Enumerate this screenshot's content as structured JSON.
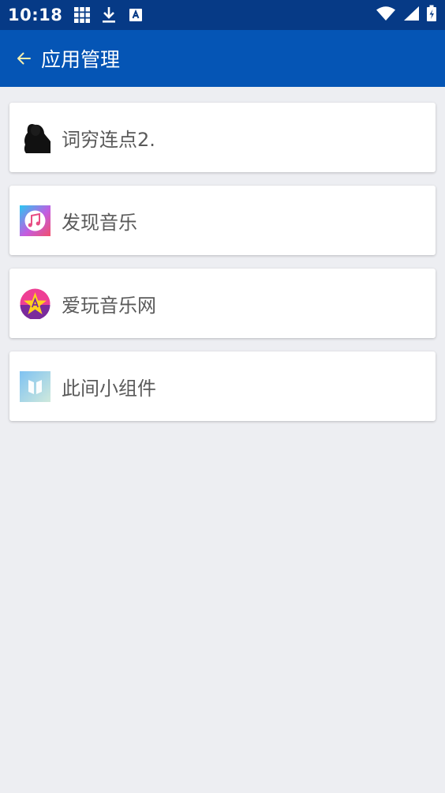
{
  "status_bar": {
    "time": "10:18",
    "left_icons": [
      "grid-icon",
      "download-icon",
      "keyboard-icon"
    ],
    "right_icons": [
      "wifi-icon",
      "signal-icon",
      "battery-icon"
    ]
  },
  "app_bar": {
    "title": "应用管理",
    "background": "#0555b5"
  },
  "apps": [
    {
      "name": "词穷连点2.",
      "icon": "silhouette-app-icon"
    },
    {
      "name": "发现音乐",
      "icon": "music-note-app-icon"
    },
    {
      "name": "爱玩音乐网",
      "icon": "star-app-icon"
    },
    {
      "name": "此间小组件",
      "icon": "book-app-icon"
    }
  ]
}
